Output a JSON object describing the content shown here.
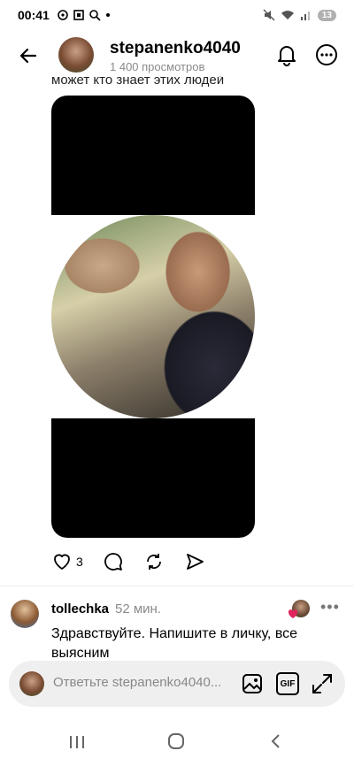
{
  "status_bar": {
    "time": "00:41",
    "battery": "13"
  },
  "header": {
    "username": "stepanenko4040",
    "views": "1 400 просмотров"
  },
  "post": {
    "caption_fragment": "может кто знает этих людей"
  },
  "actions": {
    "like_count": "3"
  },
  "comment": {
    "username": "tollechka",
    "time": "52 мин.",
    "text": "Здравствуйте. Напишите в личку, все выясним",
    "more": "•••"
  },
  "reply": {
    "placeholder": "Ответьте stepanenko4040...",
    "gif_label": "GIF"
  },
  "icons": {
    "back": "arrow-left-icon",
    "bell": "bell-icon",
    "more": "more-icon",
    "heart": "heart-icon",
    "comment": "comment-icon",
    "repost": "repost-icon",
    "share": "send-icon",
    "image": "image-icon",
    "expand": "expand-icon"
  },
  "colors": {
    "like_red": "#e0245e",
    "muted": "#8a8a8a"
  }
}
